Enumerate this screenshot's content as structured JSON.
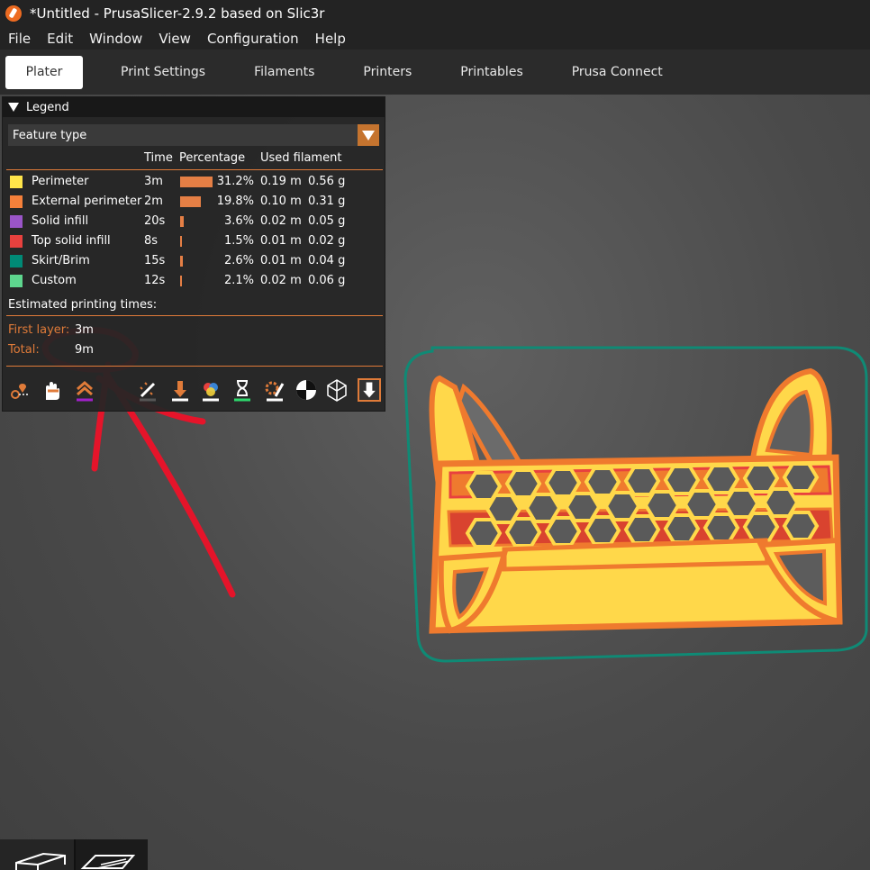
{
  "window": {
    "title": "*Untitled - PrusaSlicer-2.9.2 based on Slic3r"
  },
  "menu": [
    "File",
    "Edit",
    "Window",
    "View",
    "Configuration",
    "Help"
  ],
  "tabs": [
    {
      "label": "Plater",
      "active": true
    },
    {
      "label": "Print Settings",
      "active": false
    },
    {
      "label": "Filaments",
      "active": false
    },
    {
      "label": "Printers",
      "active": false
    },
    {
      "label": "Printables",
      "active": false
    },
    {
      "label": "Prusa Connect",
      "active": false
    }
  ],
  "legend": {
    "title": "Legend",
    "view_type": "Feature type",
    "columns": {
      "time": "Time",
      "percentage": "Percentage",
      "used_filament": "Used filament"
    },
    "rows": [
      {
        "name": "Perimeter",
        "color": "#ffe54a",
        "time": "3m",
        "percent_value": 31.2,
        "percent": "31.2%",
        "length": "0.19 m",
        "weight": "0.56 g"
      },
      {
        "name": "External perimeter",
        "color": "#f5803a",
        "time": "2m",
        "percent_value": 19.8,
        "percent": "19.8%",
        "length": "0.10 m",
        "weight": "0.31 g"
      },
      {
        "name": "Solid infill",
        "color": "#9a55c8",
        "time": "20s",
        "percent_value": 3.6,
        "percent": "3.6%",
        "length": "0.02 m",
        "weight": "0.05 g"
      },
      {
        "name": "Top solid infill",
        "color": "#e8413e",
        "time": "8s",
        "percent_value": 1.5,
        "percent": "1.5%",
        "length": "0.01 m",
        "weight": "0.02 g"
      },
      {
        "name": "Skirt/Brim",
        "color": "#008a76",
        "time": "15s",
        "percent_value": 2.6,
        "percent": "2.6%",
        "length": "0.01 m",
        "weight": "0.04 g"
      },
      {
        "name": "Custom",
        "color": "#5ed68e",
        "time": "12s",
        "percent_value": 2.1,
        "percent": "2.1%",
        "length": "0.02 m",
        "weight": "0.06 g"
      }
    ],
    "estimated_label": "Estimated printing times:",
    "first_layer_label": "First layer:",
    "first_layer_value": "3m",
    "total_label": "Total:",
    "total_value": "9m"
  },
  "toolbar_icons": [
    "travel-icon",
    "wipe-icon",
    "retractions-icon",
    "deretractions-icon",
    "seams-icon",
    "tool-changes-icon",
    "color-changes-icon",
    "pause-prints-icon",
    "custom-gcode-icon",
    "center-of-gravity-icon",
    "shells-icon",
    "tool-marker-icon"
  ],
  "accent_color": "#e07b39"
}
